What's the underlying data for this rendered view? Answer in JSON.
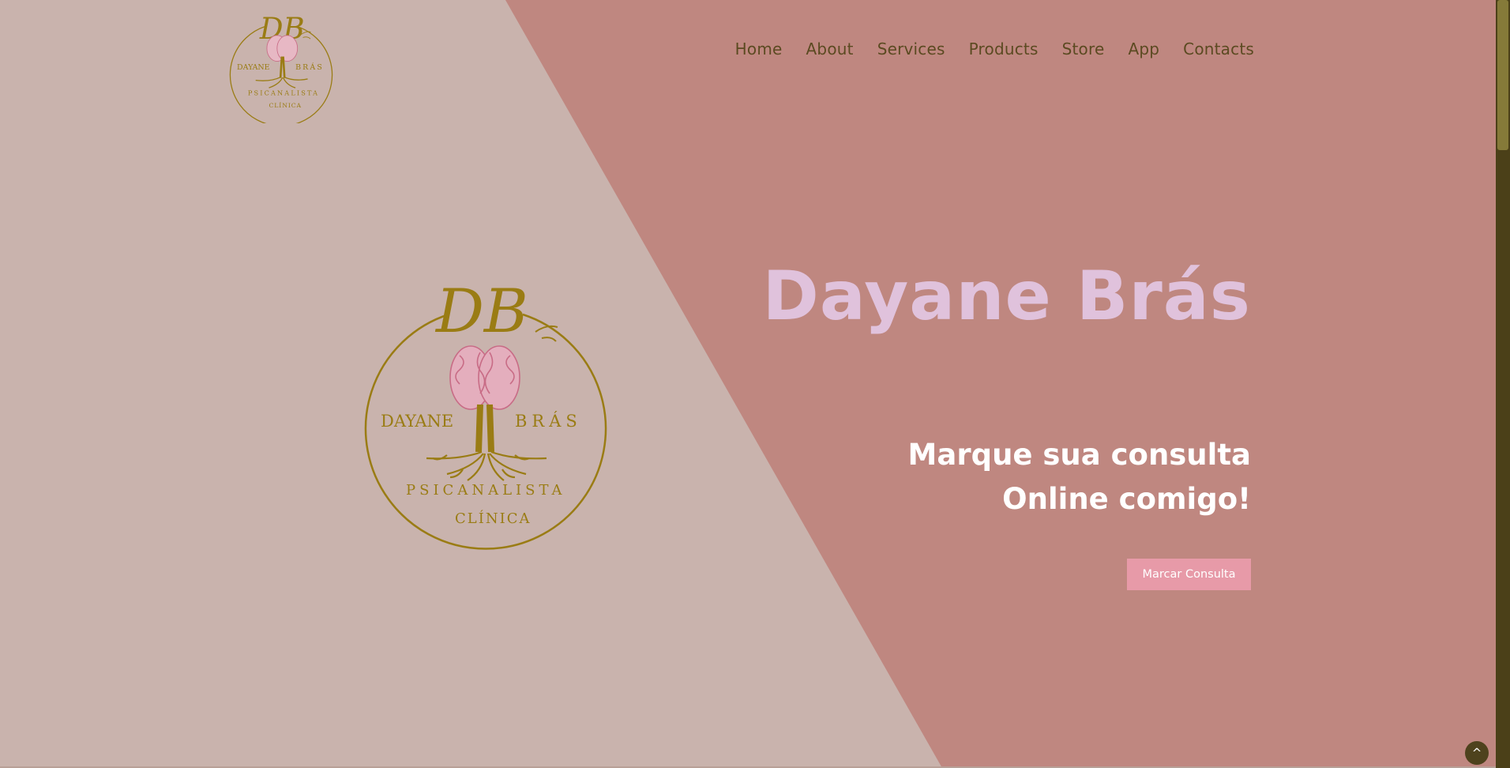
{
  "brand": {
    "name_left": "DAYANE",
    "name_right": "BRÁS",
    "monogram": "DB",
    "role": "PSICANALISTA",
    "role_sub": "CLÍNICA",
    "gold": "#9a7c14",
    "pink": "#c86c86"
  },
  "nav": {
    "items": [
      "Home",
      "About",
      "Services",
      "Products",
      "Store",
      "App",
      "Contacts"
    ]
  },
  "hero": {
    "title": "Dayane Brás",
    "subtitle": "Marque sua consulta Online comigo!",
    "cta_label": "Marcar Consulta"
  },
  "to_top": {
    "label": "^"
  },
  "colors": {
    "left_bg": "#c9b3ad",
    "right_bg": "#bf8780",
    "title": "#e0c2dc",
    "cta": "#e79aa8",
    "nav_text": "#5b4a21"
  }
}
